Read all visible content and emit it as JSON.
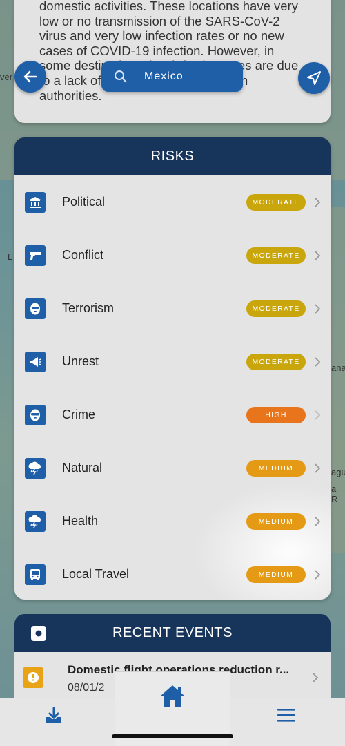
{
  "map": {
    "label_left_1": "ver",
    "label_left_2": "L",
    "label_right_1": "ana",
    "label_right_2": "agu",
    "label_right_3": "a R"
  },
  "info": {
    "text": "domestic activities. These locations have very low or no transmission of the SARS-CoV-2 virus and very low infection rates or no new cases of COVID-19 infection. However, in some destinations, low infection rates are due to a lack of testing capacity by health authorities."
  },
  "search": {
    "value": "Mexico",
    "icon": "search-icon"
  },
  "nav": {
    "back_icon": "arrow-left-icon",
    "locate_icon": "navigation-arrow-icon"
  },
  "risks": {
    "title": "RISKS",
    "items": [
      {
        "label": "Political",
        "level": "MODERATE",
        "color": "#c9a60c",
        "icon": "institution-icon"
      },
      {
        "label": "Conflict",
        "level": "MODERATE",
        "color": "#c9a60c",
        "icon": "gun-icon"
      },
      {
        "label": "Terrorism",
        "level": "MODERATE",
        "color": "#c9a60c",
        "icon": "balaclava-icon"
      },
      {
        "label": "Unrest",
        "level": "MODERATE",
        "color": "#c9a60c",
        "icon": "megaphone-icon"
      },
      {
        "label": "Crime",
        "level": "HIGH",
        "color": "#e8741c",
        "icon": "masked-face-icon"
      },
      {
        "label": "Natural",
        "level": "MEDIUM",
        "color": "#e49a14",
        "icon": "storm-cloud-icon"
      },
      {
        "label": "Health",
        "level": "MEDIUM",
        "color": "#e49a14",
        "icon": "storm-cloud-icon"
      },
      {
        "label": "Local Travel",
        "level": "MEDIUM",
        "color": "#e49a14",
        "icon": "bus-icon"
      }
    ]
  },
  "events": {
    "title": "RECENT EVENTS",
    "items": [
      {
        "title": "Domestic flight operations reduction r...",
        "date": "08/01/2",
        "icon": "alert-icon"
      }
    ]
  },
  "bottom_nav": {
    "download_icon": "download-tray-icon",
    "home_icon": "home-icon",
    "menu_icon": "hamburger-menu-icon"
  },
  "colors": {
    "navy": "#17345a",
    "blue": "#1f5fa8",
    "moderate": "#c9a60c",
    "high": "#e8741c",
    "medium": "#e49a14"
  }
}
